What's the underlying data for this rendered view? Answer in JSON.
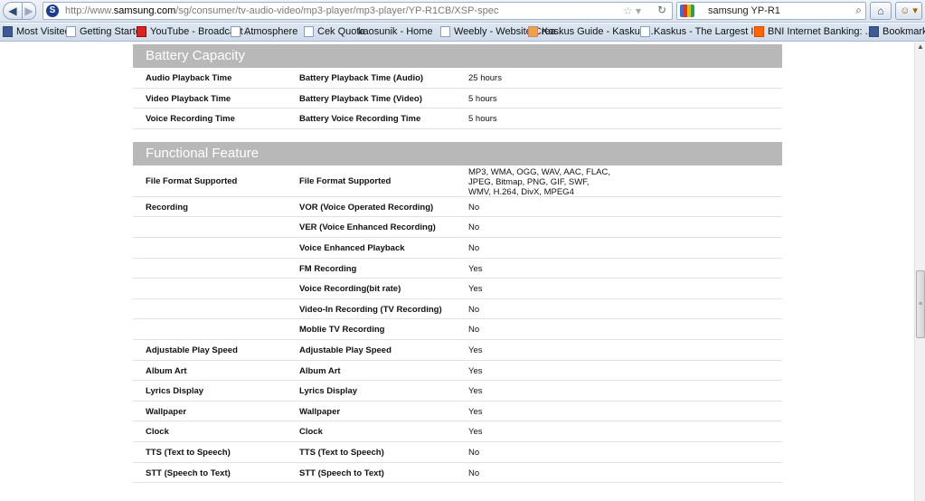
{
  "browser": {
    "url_prefix": "http://www.",
    "url_domain": "samsung.com",
    "url_path": "/sg/consumer/tv-audio-video/mp3-player/mp3-player/YP-R1CB/XSP-spec",
    "site_icon_letter": "S",
    "search_value": "samsung YP-R1"
  },
  "bookmarks": [
    {
      "label": "Most Visited",
      "icon": "blue"
    },
    {
      "label": "Getting Started",
      "icon": "page"
    },
    {
      "label": "YouTube - Broadcast ...",
      "icon": "red"
    },
    {
      "label": "Atmosphere",
      "icon": "page"
    },
    {
      "label": "Cek Quota",
      "icon": "page"
    },
    {
      "label": "kaosunik - Home",
      "icon": "none"
    },
    {
      "label": "Weebly - Website Crea...",
      "icon": "page"
    },
    {
      "label": "Kaskus Guide - Kaskus ...",
      "icon": "ks"
    },
    {
      "label": "Kaskus - The Largest I...",
      "icon": "page"
    },
    {
      "label": "BNI Internet Banking: ...",
      "icon": "bni"
    },
    {
      "label": "Bookmarks",
      "icon": "blue"
    }
  ],
  "sections": [
    {
      "title": "Battery Capacity",
      "rows": [
        {
          "group": "Audio Playback Time",
          "item": "Battery Playback Time (Audio)",
          "value": "25 hours"
        },
        {
          "group": "Video Playback Time",
          "item": "Battery Playback Time (Video)",
          "value": "5 hours"
        },
        {
          "group": "Voice Recording Time",
          "item": "Battery Voice Recording Time",
          "value": "5 hours"
        }
      ]
    },
    {
      "title": "Functional Feature",
      "rows": [
        {
          "group": "File Format Supported",
          "item": "File Format Supported",
          "value_lines": [
            "MP3, WMA, OGG, WAV, AAC, FLAC,",
            "JPEG, Bitmap, PNG, GIF, SWF,",
            "WMV, H.264, DivX, MPEG4"
          ]
        },
        {
          "group": "Recording",
          "item": "VOR (Voice Operated Recording)",
          "value": "No"
        },
        {
          "group": "",
          "item": "VER (Voice Enhanced Recording)",
          "value": "No"
        },
        {
          "group": "",
          "item": "Voice Enhanced Playback",
          "value": "No"
        },
        {
          "group": "",
          "item": "FM Recording",
          "value": "Yes"
        },
        {
          "group": "",
          "item": "Voice Recording(bit rate)",
          "value": "Yes"
        },
        {
          "group": "",
          "item": "Video-In Recording (TV Recording)",
          "value": "No"
        },
        {
          "group": "",
          "item": "Moblie TV Recording",
          "value": "No"
        },
        {
          "group": "Adjustable Play Speed",
          "item": "Adjustable Play Speed",
          "value": "Yes"
        },
        {
          "group": "Album Art",
          "item": "Album Art",
          "value": "Yes"
        },
        {
          "group": "Lyrics Display",
          "item": "Lyrics Display",
          "value": "Yes"
        },
        {
          "group": "Wallpaper",
          "item": "Wallpaper",
          "value": "Yes"
        },
        {
          "group": "Clock",
          "item": "Clock",
          "value": "Yes"
        },
        {
          "group": "TTS (Text to Speech)",
          "item": "TTS (Text to Speech)",
          "value": "No"
        },
        {
          "group": "STT (Speech to Text)",
          "item": "STT (Speech to Text)",
          "value": "No"
        }
      ]
    }
  ]
}
